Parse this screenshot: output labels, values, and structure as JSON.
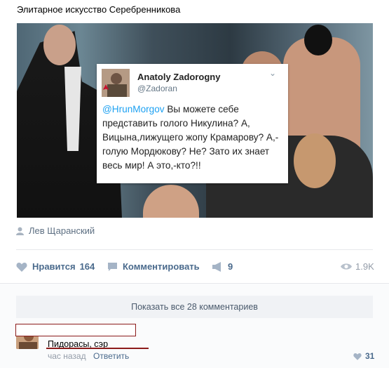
{
  "post": {
    "text": "Элитарное искусство Серебренникова",
    "author": "Лев Щаранский"
  },
  "tweet": {
    "name": "Anatoly Zadorogny",
    "handle": "@Zadoran",
    "mention": "@HrunMorgov",
    "body": " Вы можете себе представить голого Никулина? А, Вицына,лижущего жопу Крамарову? А,-голую Мордюкову? Не? Зато их знает весь мир! А это,-кто?!!"
  },
  "actions": {
    "like_label": "Нравится",
    "like_count": "164",
    "comment_label": "Комментировать",
    "share_count": "9",
    "views": "1.9K"
  },
  "comments": {
    "show_all": "Показать все 28 комментариев",
    "items": [
      {
        "text": "Пидорасы, сэр",
        "time": "час назад",
        "reply": "Ответить",
        "likes": "31"
      }
    ]
  },
  "colors": {
    "link": "#4a6a8c",
    "muted": "#939ca8",
    "redaction": "#8c1b1b",
    "tweet_link": "#1da1f2"
  },
  "icons": [
    "user-icon",
    "heart-icon",
    "comment-icon",
    "share-icon",
    "eye-icon",
    "heart-icon-small",
    "chevron-down-icon"
  ]
}
